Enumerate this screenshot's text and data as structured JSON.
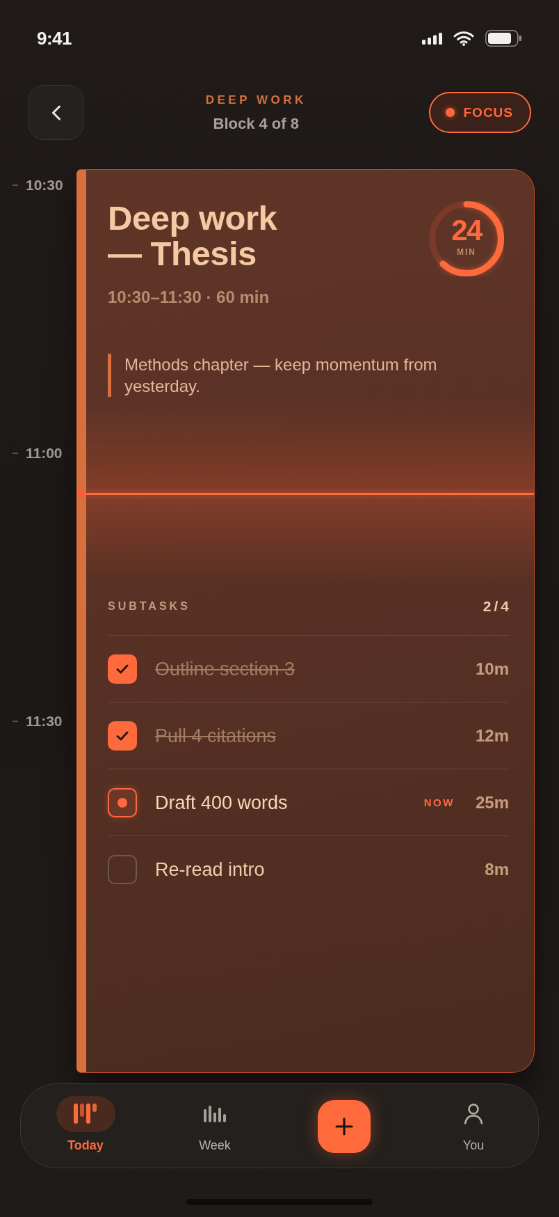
{
  "status_bar": {
    "time": "9:41"
  },
  "header": {
    "eyebrow": "DEEP WORK",
    "subtitle": "Block 4 of 8",
    "focus": {
      "label": "FOCUS",
      "on": true
    }
  },
  "timeline": {
    "times": [
      "10:30",
      "11:00",
      "11:30"
    ]
  },
  "event": {
    "title": "Deep work — Thesis",
    "time_range": "10:30–11:30 · 60 min",
    "timer": {
      "value": "24",
      "unit": "MIN",
      "level": 0.62
    },
    "note": "Methods chapter — keep momentum from yesterday."
  },
  "subtasks": {
    "label": "SUBTASKS",
    "count": "2/4",
    "items": [
      {
        "title": "Outline section 3",
        "duration": "10m",
        "checked": true,
        "active": false
      },
      {
        "title": "Pull 4 citations",
        "duration": "12m",
        "checked": true,
        "active": false
      },
      {
        "title": "Draft 400 words",
        "badge": "NOW",
        "duration": "25m",
        "checked": false,
        "active": true
      },
      {
        "title": "Re-read intro",
        "duration": "8m",
        "checked": false,
        "active": false
      }
    ]
  },
  "tab_bar": {
    "items": [
      {
        "kind": "tab",
        "label": "Today",
        "selected": true
      },
      {
        "kind": "tab",
        "label": "Week",
        "selected": false
      },
      {
        "kind": "add"
      },
      {
        "kind": "tab",
        "label": "You",
        "selected": false
      }
    ]
  }
}
